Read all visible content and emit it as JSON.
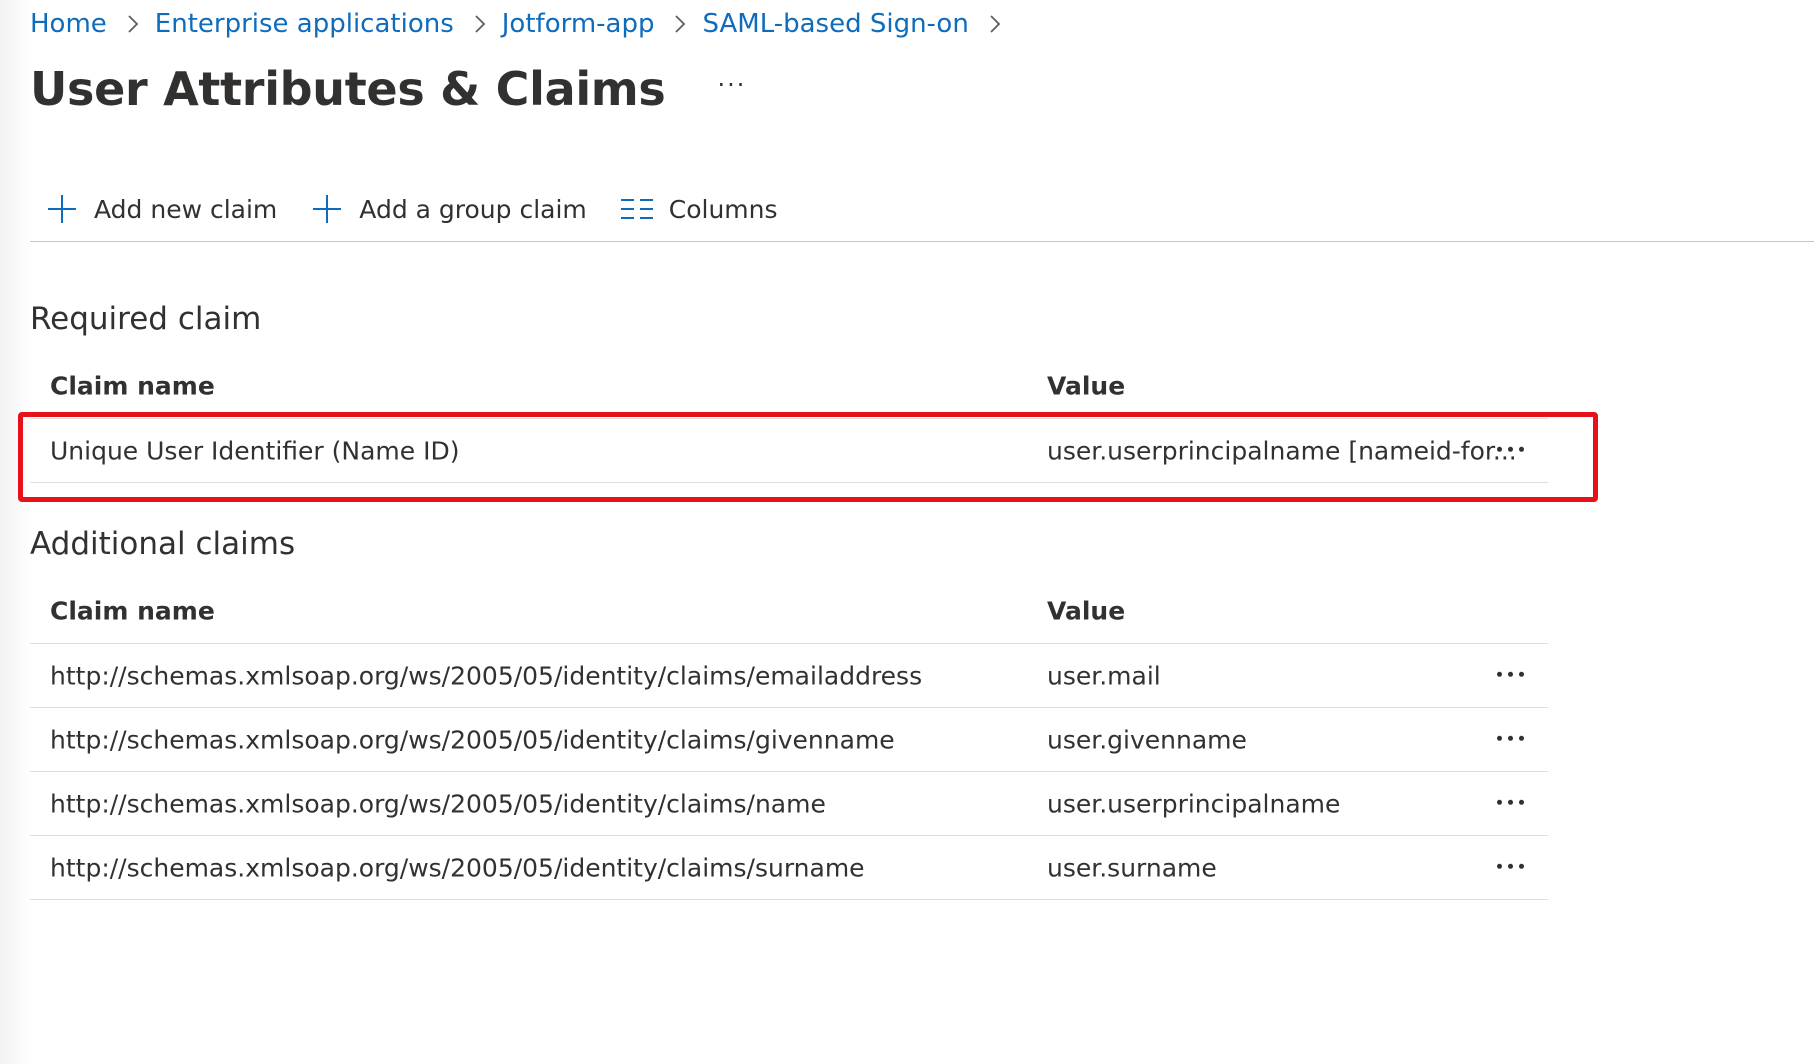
{
  "breadcrumb": {
    "items": [
      "Home",
      "Enterprise applications",
      "Jotform-app",
      "SAML-based Sign-on"
    ]
  },
  "page": {
    "title": "User Attributes & Claims",
    "more_label": "···"
  },
  "toolbar": {
    "add_claim_label": "Add new claim",
    "add_group_claim_label": "Add a group claim",
    "columns_label": "Columns"
  },
  "required": {
    "heading": "Required claim",
    "columns": {
      "name": "Claim name",
      "value": "Value"
    },
    "rows": [
      {
        "name": "Unique User Identifier (Name ID)",
        "value": "user.userprincipalname [nameid-for..."
      }
    ]
  },
  "additional": {
    "heading": "Additional claims",
    "columns": {
      "name": "Claim name",
      "value": "Value"
    },
    "rows": [
      {
        "name": "http://schemas.xmlsoap.org/ws/2005/05/identity/claims/emailaddress",
        "value": "user.mail"
      },
      {
        "name": "http://schemas.xmlsoap.org/ws/2005/05/identity/claims/givenname",
        "value": "user.givenname"
      },
      {
        "name": "http://schemas.xmlsoap.org/ws/2005/05/identity/claims/name",
        "value": "user.userprincipalname"
      },
      {
        "name": "http://schemas.xmlsoap.org/ws/2005/05/identity/claims/surname",
        "value": "user.surname"
      }
    ]
  },
  "icons": {
    "add": "plus-icon",
    "columns": "columns-icon",
    "more": "more-horizontal-icon",
    "separator": "chevron-right-icon"
  },
  "colors": {
    "link": "#0f6cbd",
    "text": "#323130",
    "highlight": "#e8101a",
    "divider": "#dedede"
  }
}
